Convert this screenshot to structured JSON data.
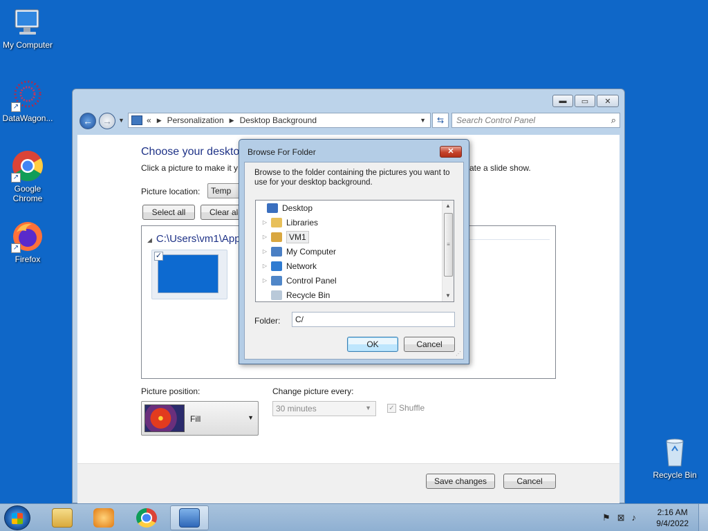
{
  "desktop": {
    "icons": [
      {
        "label": "My Computer"
      },
      {
        "label": "DataWagon..."
      },
      {
        "label": "Google Chrome"
      },
      {
        "label": "Firefox"
      },
      {
        "label": "Recycle Bin"
      }
    ]
  },
  "window": {
    "controls": {
      "minimize": "▬",
      "maximize": "▭",
      "close": "✕"
    },
    "breadcrumb": {
      "prefix": "«",
      "items": [
        "Personalization",
        "Desktop Background"
      ]
    },
    "search_placeholder": "Search Control Panel",
    "heading": "Choose your desktop",
    "subtext_left": "Click a picture to make it y",
    "subtext_right": "ate a slide show.",
    "picture_location_label": "Picture location:",
    "picture_location_value": "Temp",
    "select_all": "Select all",
    "clear_all": "Clear all",
    "folder_path": "C:\\Users\\vm1\\App",
    "thumbnail_checked": "✓",
    "picture_position_label": "Picture position:",
    "picture_position_value": "Fill",
    "change_picture_label": "Change picture every:",
    "change_picture_value": "30 minutes",
    "shuffle_label": "Shuffle",
    "save_changes": "Save changes",
    "cancel": "Cancel"
  },
  "dialog": {
    "title": "Browse For Folder",
    "close": "✕",
    "description": "Browse to the folder containing the pictures you want to use for your desktop background.",
    "tree": [
      {
        "label": "Desktop",
        "icon": "desktop-icon",
        "color": "#3a6fbf",
        "expandable": false,
        "selected": false
      },
      {
        "label": "Libraries",
        "icon": "libraries-icon",
        "color": "#e8c05a",
        "expandable": true,
        "selected": false
      },
      {
        "label": "VM1",
        "icon": "user-folder-icon",
        "color": "#d9a740",
        "expandable": true,
        "selected": true
      },
      {
        "label": "My Computer",
        "icon": "computer-icon",
        "color": "#4a7fc4",
        "expandable": true,
        "selected": false
      },
      {
        "label": "Network",
        "icon": "network-icon",
        "color": "#2f7bd1",
        "expandable": true,
        "selected": false
      },
      {
        "label": "Control Panel",
        "icon": "control-panel-icon",
        "color": "#4f86c8",
        "expandable": true,
        "selected": false
      },
      {
        "label": "Recycle Bin",
        "icon": "recycle-bin-icon",
        "color": "#b9c9d9",
        "expandable": false,
        "selected": false
      }
    ],
    "folder_label": "Folder:",
    "folder_value": "C/",
    "ok": "OK",
    "cancel": "Cancel"
  },
  "taskbar": {
    "clock_time": "2:16 AM",
    "clock_date": "9/4/2022"
  }
}
